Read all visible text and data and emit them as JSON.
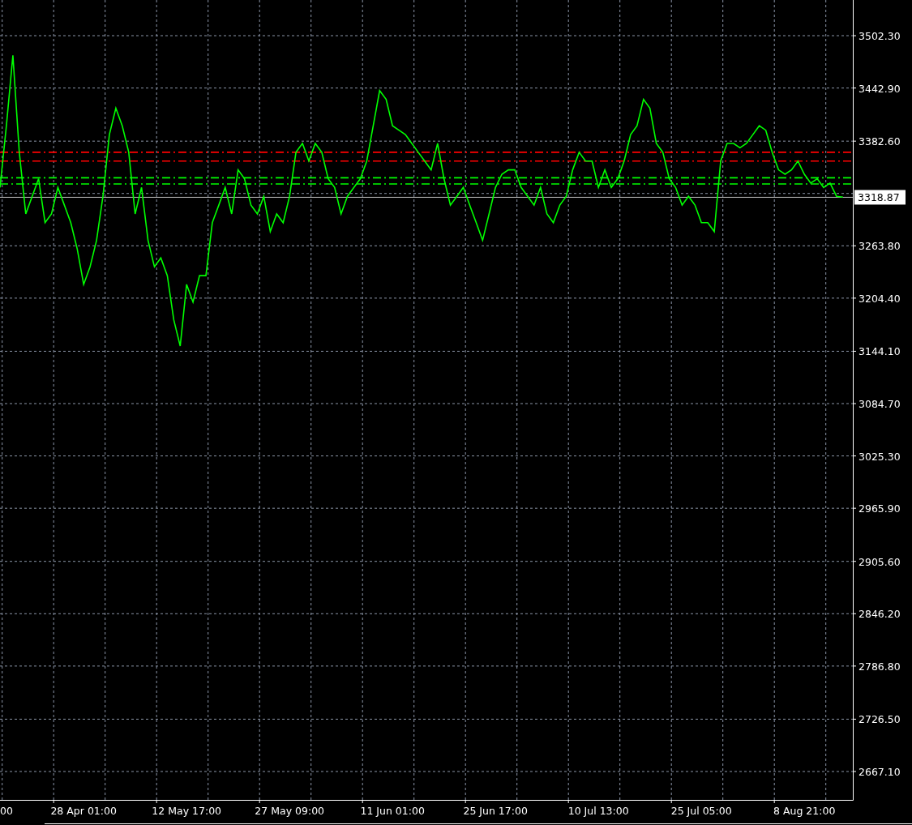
{
  "chart": {
    "chart_data": {
      "type": "line",
      "grid": true,
      "ylim": [
        2634.9,
        3542.8
      ],
      "categories": [
        null,
        "00",
        null,
        null,
        null,
        null,
        null,
        null,
        null,
        null,
        null,
        null,
        null,
        "28 Apr 01:00",
        null,
        null,
        null,
        null,
        null,
        null,
        null,
        null,
        null,
        null,
        null,
        null,
        null,
        null,
        null,
        "12 May 17:00",
        null,
        null,
        null,
        null,
        null,
        null,
        null,
        null,
        null,
        null,
        null,
        null,
        null,
        null,
        null,
        "27 May 09:00",
        null,
        null,
        null,
        null,
        null,
        null,
        null,
        null,
        null,
        null,
        null,
        null,
        null,
        null,
        null,
        "11 Jun 01:00",
        null,
        null,
        null,
        null,
        null,
        null,
        null,
        null,
        null,
        null,
        null,
        null,
        null,
        null,
        null,
        "25 Jun 17:00",
        null,
        null,
        null,
        null,
        null,
        null,
        null,
        null,
        null,
        null,
        null,
        null,
        null,
        null,
        null,
        "10 Jul 13:00",
        null,
        null,
        null,
        null,
        null,
        null,
        null,
        null,
        null,
        null,
        null,
        null,
        null,
        null,
        null,
        "25 Jul 05:00",
        null,
        null,
        null,
        null,
        null,
        null,
        null,
        null,
        null,
        null,
        null,
        null,
        null,
        null,
        null,
        "8 Aug 21:00",
        null,
        null,
        null,
        null,
        null,
        null
      ],
      "series": [
        {
          "color": "#00ff00",
          "values": [
            3330,
            3400,
            3480,
            3370,
            3300,
            3320,
            3340,
            3290,
            3300,
            3330,
            3310,
            3290,
            3260,
            3220,
            3240,
            3270,
            3320,
            3390,
            3420,
            3400,
            3370,
            3300,
            3330,
            3270,
            3240,
            3250,
            3230,
            3180,
            3150,
            3220,
            3200,
            3230,
            3230,
            3290,
            3310,
            3330,
            3300,
            3350,
            3340,
            3310,
            3300,
            3320,
            3280,
            3300,
            3290,
            3320,
            3370,
            3380,
            3360,
            3380,
            3370,
            3340,
            3330,
            3300,
            3320,
            3330,
            3340,
            3360,
            3400,
            3440,
            3430,
            3400,
            3395,
            3390,
            3380,
            3370,
            3360,
            3350,
            3380,
            3340,
            3310,
            3320,
            3330,
            3310,
            3290,
            3270,
            3300,
            3330,
            3345,
            3350,
            3350,
            3330,
            3320,
            3310,
            3330,
            3300,
            3290,
            3310,
            3320,
            3350,
            3370,
            3360,
            3360,
            3330,
            3350,
            3330,
            3340,
            3360,
            3390,
            3400,
            3430,
            3420,
            3380,
            3370,
            3340,
            3330,
            3310,
            3320,
            3310,
            3290,
            3290,
            3280,
            3360,
            3380,
            3380,
            3375,
            3380,
            3390,
            3400,
            3395,
            3370,
            3350,
            3345,
            3350,
            3360,
            3345,
            3335,
            3340,
            3330,
            3335,
            3320,
            3319
          ]
        }
      ],
      "yticks": [
        {
          "value": 3502.3,
          "label": "3502.30"
        },
        {
          "value": 3442.9,
          "label": "3442.90"
        },
        {
          "value": 3382.6,
          "label": "3382.60"
        },
        {
          "value": 3263.8,
          "label": "3263.80"
        },
        {
          "value": 3204.4,
          "label": "3204.40"
        },
        {
          "value": 3144.1,
          "label": "3144.10"
        },
        {
          "value": 3084.7,
          "label": "3084.70"
        },
        {
          "value": 3025.3,
          "label": "3025.30"
        },
        {
          "value": 2965.9,
          "label": "2965.90"
        },
        {
          "value": 2905.6,
          "label": "2905.60"
        },
        {
          "value": 2846.2,
          "label": "2846.20"
        },
        {
          "value": 2786.8,
          "label": "2786.80"
        },
        {
          "value": 2726.5,
          "label": "2726.50"
        },
        {
          "value": 2667.1,
          "label": "2667.10"
        }
      ],
      "ref_lines": [
        {
          "axis": "y",
          "value": 3370,
          "color": "#ff0000"
        },
        {
          "axis": "y",
          "value": 3360,
          "color": "#ff0000"
        },
        {
          "axis": "y",
          "value": 3341,
          "color": "#00ff00"
        },
        {
          "axis": "y",
          "value": 3334,
          "color": "#00ff00"
        },
        {
          "axis": "y",
          "value": 3318.87,
          "color": "#c0c0c0",
          "label": "3318.87"
        }
      ]
    }
  }
}
